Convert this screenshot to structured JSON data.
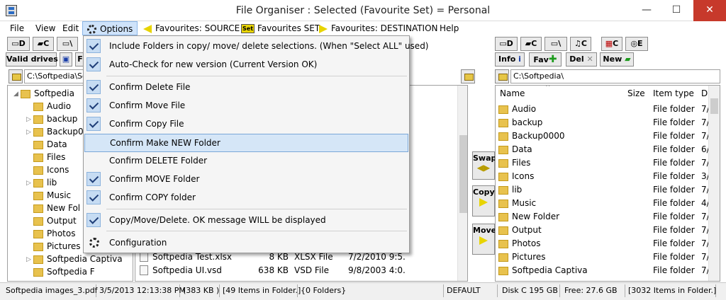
{
  "window": {
    "title": "File Organiser :    Selected (Favourite Set) =  Personal",
    "minimize": "—",
    "maximize": "☐",
    "close": "✕"
  },
  "menu": {
    "file": "File",
    "view": "View",
    "edit": "Edit",
    "options": "Options",
    "fav_source": "Favourites: SOURCE",
    "fav_set": "Favourites SET",
    "set_icon": "Set",
    "fav_dest": "Favourites: DESTINATION",
    "help": "Help"
  },
  "left_toolbar": {
    "drive_d": "D",
    "drive_c": "C",
    "drive_root": "\\",
    "valid_drives": "Valid drives",
    "f_btn": "F"
  },
  "right_toolbar": {
    "drive_d": "D",
    "drive_c": "C",
    "drive_root": "\\",
    "music_c": "C",
    "film_c": "C",
    "disc_e": "E",
    "info": "Info",
    "fav": "Fav",
    "del": "Del",
    "new": "New"
  },
  "left_path": "C:\\Softpedia\\So",
  "right_path": "C:\\Softpedia\\",
  "left_tree": [
    {
      "name": "Softpedia"
    },
    {
      "name": "Audio"
    },
    {
      "name": "backup"
    },
    {
      "name": "Backup0"
    },
    {
      "name": "Data"
    },
    {
      "name": "Files"
    },
    {
      "name": "Icons"
    },
    {
      "name": "lib"
    },
    {
      "name": "Music"
    },
    {
      "name": "New Fol"
    },
    {
      "name": "Output"
    },
    {
      "name": "Photos"
    },
    {
      "name": "Pictures"
    },
    {
      "name": "Softpedia Captiva"
    },
    {
      "name": "Softpedia F"
    }
  ],
  "middle_files": [
    {
      "name": "Softpedia Test.xlsx",
      "size": "8 KB",
      "type": "XLSX File",
      "date": "7/2/2010 9:5..."
    },
    {
      "name": "Softpedia UI.vsd",
      "size": "638 KB",
      "type": "VSD File",
      "date": "9/8/2003 4:0..."
    }
  ],
  "middle_buttons": {
    "swap": "Swap",
    "copy": "Copy",
    "move": "Move"
  },
  "right_list": {
    "columns": {
      "name": "Name",
      "size": "Size",
      "type": "Item type",
      "date": "D"
    },
    "rows": [
      {
        "name": "Audio",
        "type": "File folder",
        "date": "7/"
      },
      {
        "name": "backup",
        "type": "File folder",
        "date": "7/"
      },
      {
        "name": "Backup0000",
        "type": "File folder",
        "date": "7/"
      },
      {
        "name": "Data",
        "type": "File folder",
        "date": "6/"
      },
      {
        "name": "Files",
        "type": "File folder",
        "date": "7/"
      },
      {
        "name": "Icons",
        "type": "File folder",
        "date": "3/"
      },
      {
        "name": "lib",
        "type": "File folder",
        "date": "7/"
      },
      {
        "name": "Music",
        "type": "File folder",
        "date": "4/"
      },
      {
        "name": "New Folder",
        "type": "File folder",
        "date": "7/"
      },
      {
        "name": "Output",
        "type": "File folder",
        "date": "7/"
      },
      {
        "name": "Photos",
        "type": "File folder",
        "date": "7/"
      },
      {
        "name": "Pictures",
        "type": "File folder",
        "date": "7/"
      },
      {
        "name": "Softpedia Captiva",
        "type": "File folder",
        "date": "7/"
      }
    ]
  },
  "options_menu": [
    {
      "label": "Include Folders in copy/ move/ delete selections. (When \"Select ALL\" used)",
      "checked": true
    },
    {
      "label": "Auto-Check for new version (Current Version OK)",
      "checked": true
    },
    {
      "label": "Confirm Delete File",
      "checked": true
    },
    {
      "label": "Confirm Move File",
      "checked": true
    },
    {
      "label": "Confirm Copy File",
      "checked": true
    },
    {
      "label": "Confirm Make NEW Folder",
      "checked": false
    },
    {
      "label": "Confirm DELETE Folder",
      "checked": false
    },
    {
      "label": "Confirm MOVE Folder",
      "checked": true
    },
    {
      "label": "Confirm COPY folder",
      "checked": true
    },
    {
      "label": "Copy/Move/Delete.  OK message WILL be displayed",
      "checked": true
    },
    {
      "label": "Configuration",
      "checked": false
    }
  ],
  "status": {
    "file": "Softpedia images_3.pdf",
    "datetime": "3/5/2013 12:13:38 PM",
    "size": "(383 KB )",
    "items": "[49 Items in Folder.]",
    "folders": "{0 Folders}",
    "mode": "DEFAULT",
    "disk": "Disk C 195 GB",
    "free": "Free: 27.6 GB",
    "right_items": "[3032 Items in Folder.]"
  },
  "colors": {
    "accent": "#cfe3fa",
    "folder": "#e8c24e",
    "arrow": "#e8d400",
    "close": "#c7392b"
  }
}
